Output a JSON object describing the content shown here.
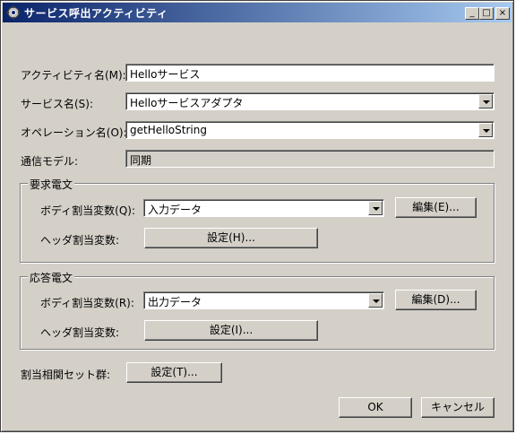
{
  "window": {
    "title": "サービス呼出アクティビティ",
    "minimize": "_",
    "maximize": "□",
    "close": "×"
  },
  "form": {
    "activity_name_label": "アクティビティ名(M):",
    "activity_name_value": "Helloサービス",
    "service_name_label": "サービス名(S):",
    "service_name_value": "Helloサービスアダプタ",
    "operation_name_label": "オペレーション名(O):",
    "operation_name_value": "getHelloString",
    "comm_model_label": "通信モデル:",
    "comm_model_value": "同期"
  },
  "request": {
    "group_title": "要求電文",
    "body_label": "ボディ割当変数(Q):",
    "body_value": "入力データ",
    "edit_button": "編集(E)...",
    "header_label": "ヘッダ割当変数:",
    "header_button": "設定(H)..."
  },
  "response": {
    "group_title": "応答電文",
    "body_label": "ボディ割当変数(R):",
    "body_value": "出力データ",
    "edit_button": "編集(D)...",
    "header_label": "ヘッダ割当変数:",
    "header_button": "設定(I)..."
  },
  "correlation": {
    "label": "割当相関セット群:",
    "button": "設定(T)..."
  },
  "footer": {
    "ok": "OK",
    "cancel": "キャンセル"
  }
}
